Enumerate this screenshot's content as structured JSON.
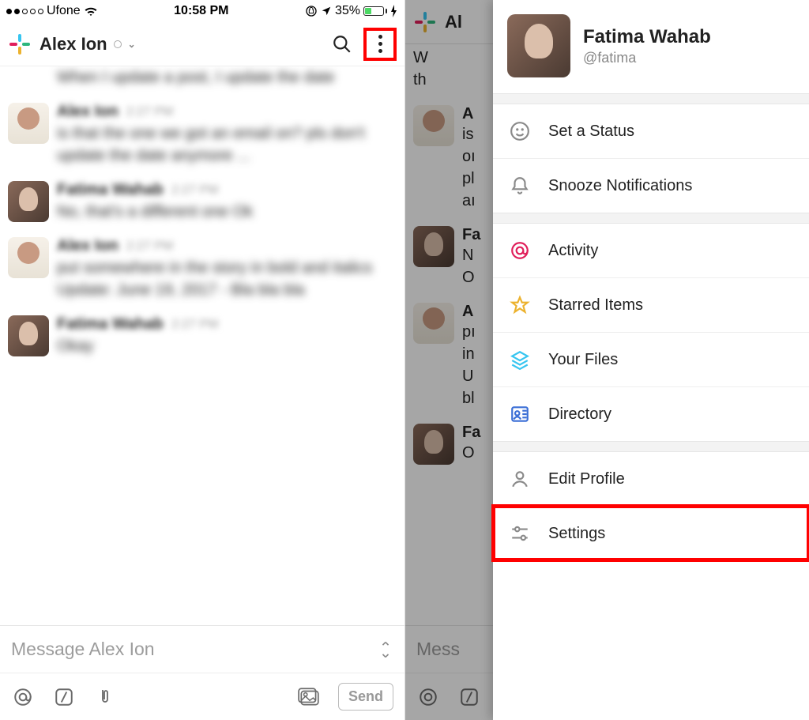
{
  "statusbar": {
    "carrier": "Ufone",
    "time": "10:58 PM",
    "battery_pct": "35%"
  },
  "left": {
    "header": {
      "title": "Alex Ion"
    },
    "messages": {
      "partial_top": "When I update a post, I update the date",
      "m1": {
        "sender": "Alex Ion",
        "time": "2:27 PM",
        "text": "is that the one we got an email on?\npls don't update the date anymore ..."
      },
      "m2": {
        "sender": "Fatima Wahab",
        "time": "2:27 PM",
        "text": "No, that's a different one\nOk"
      },
      "m3": {
        "sender": "Alex Ion",
        "time": "2:27 PM",
        "text": "put somewhere in the story in bold and italics\nUpdate: June 19, 2017 - Bla bla bla"
      },
      "m4": {
        "sender": "Fatima Wahab",
        "time": "2:27 PM",
        "text": "Okay"
      }
    },
    "composer": {
      "placeholder": "Message Alex Ion",
      "send": "Send"
    }
  },
  "right": {
    "header": {
      "title_initial": "Al"
    },
    "undertext": {
      "l1": "W",
      "l2": "th",
      "m1_sender": "A",
      "m1_l1": "is",
      "m1_l2": "oı",
      "m1_l3": "pl",
      "m1_l4": "aı",
      "m2_sender": "Fa",
      "m2_l1": "N",
      "m2_l2": "O",
      "m3_sender": "A",
      "m3_l1": "pı",
      "m3_l2": "in",
      "m3_l3": "U",
      "m3_l4": "bl",
      "m4_sender": "Fa",
      "m4_l1": "O"
    },
    "composer_peek": "Mess",
    "drawer": {
      "name": "Fatima Wahab",
      "handle": "@fatima",
      "items": {
        "status": "Set a Status",
        "snooze": "Snooze Notifications",
        "activity": "Activity",
        "starred": "Starred Items",
        "files": "Your Files",
        "directory": "Directory",
        "edit_profile": "Edit Profile",
        "settings": "Settings"
      }
    }
  }
}
